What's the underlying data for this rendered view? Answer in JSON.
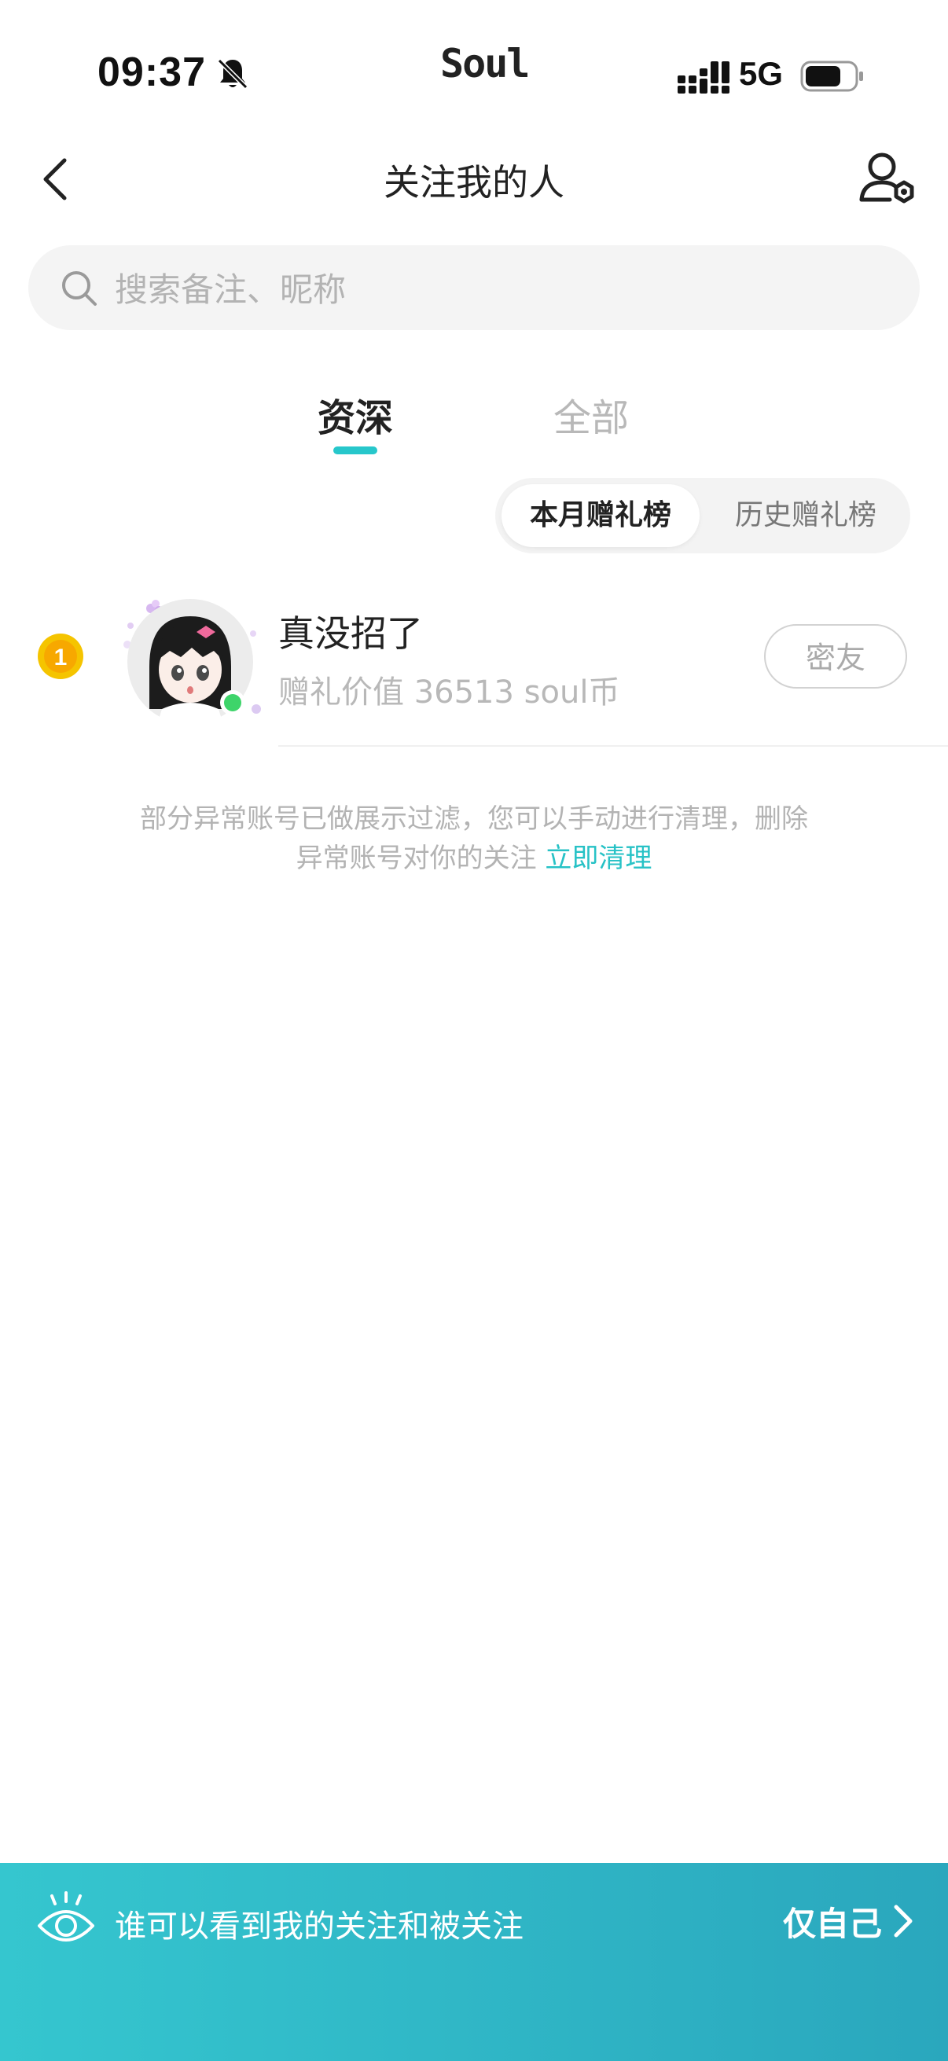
{
  "status_bar": {
    "time": "09:37",
    "app_name": "Soul",
    "network": "5G"
  },
  "nav": {
    "title": "关注我的人"
  },
  "search": {
    "placeholder": "搜索备注、昵称",
    "value": ""
  },
  "tabs": [
    {
      "label": "资深",
      "active": true
    },
    {
      "label": "全部",
      "active": false
    }
  ],
  "segments": [
    {
      "label": "本月赠礼榜",
      "active": true
    },
    {
      "label": "历史赠礼榜",
      "active": false
    }
  ],
  "list": [
    {
      "rank": "1",
      "name": "真没招了",
      "gift_value": "赠礼价值 36513 soul币",
      "button": "密友"
    }
  ],
  "notice": {
    "line1": "部分异常账号已做展示过滤，您可以手动进行清理，删除",
    "line2": "异常账号对你的关注",
    "link": "立即清理"
  },
  "bottom_bar": {
    "text": "谁可以看到我的关注和被关注",
    "value": "仅自己"
  },
  "colors": {
    "accent": "#27c7cb",
    "rank_gold": "#f5c400",
    "online": "#3ed46a"
  }
}
